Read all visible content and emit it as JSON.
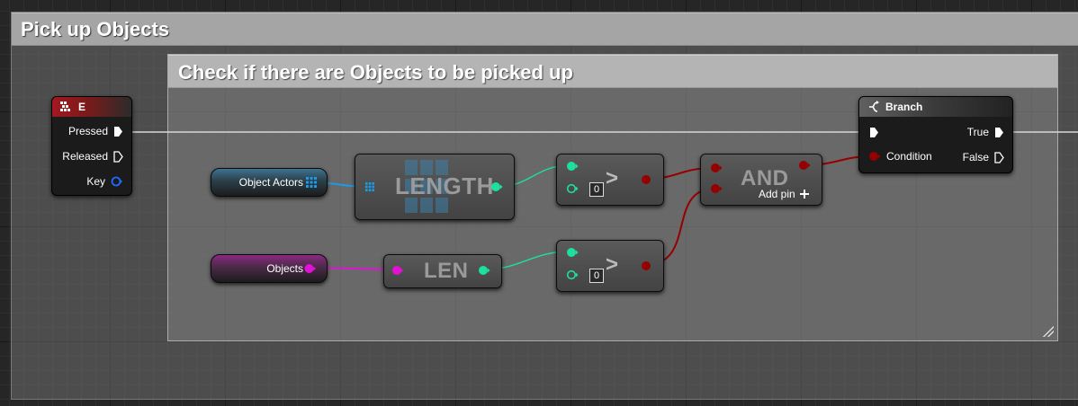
{
  "outer_comment": {
    "title": "Pick up Objects"
  },
  "inner_comment": {
    "title": "Check if there are Objects to be picked up"
  },
  "event_node": {
    "title": "E",
    "pins": [
      {
        "label": "Pressed"
      },
      {
        "label": "Released"
      },
      {
        "label": "Key"
      }
    ]
  },
  "variables": {
    "object_actors": "Object Actors",
    "objects": "Objects"
  },
  "length_node": {
    "title": "LENGTH"
  },
  "len_node": {
    "title": "LEN"
  },
  "compare_nodes": [
    {
      "symbol": ">",
      "default_value": "0"
    },
    {
      "symbol": ">",
      "default_value": "0"
    }
  ],
  "and_node": {
    "title": "AND",
    "add_pin_label": "Add pin"
  },
  "branch_node": {
    "title": "Branch",
    "condition_label": "Condition",
    "true_label": "True",
    "false_label": "False"
  },
  "colors": {
    "exec": "#ffffff",
    "bool": "#950000",
    "int": "#1ddfa0",
    "array_actor": "#1b9be8",
    "string": "#e013d4",
    "struct_key": "#1e6bff"
  }
}
